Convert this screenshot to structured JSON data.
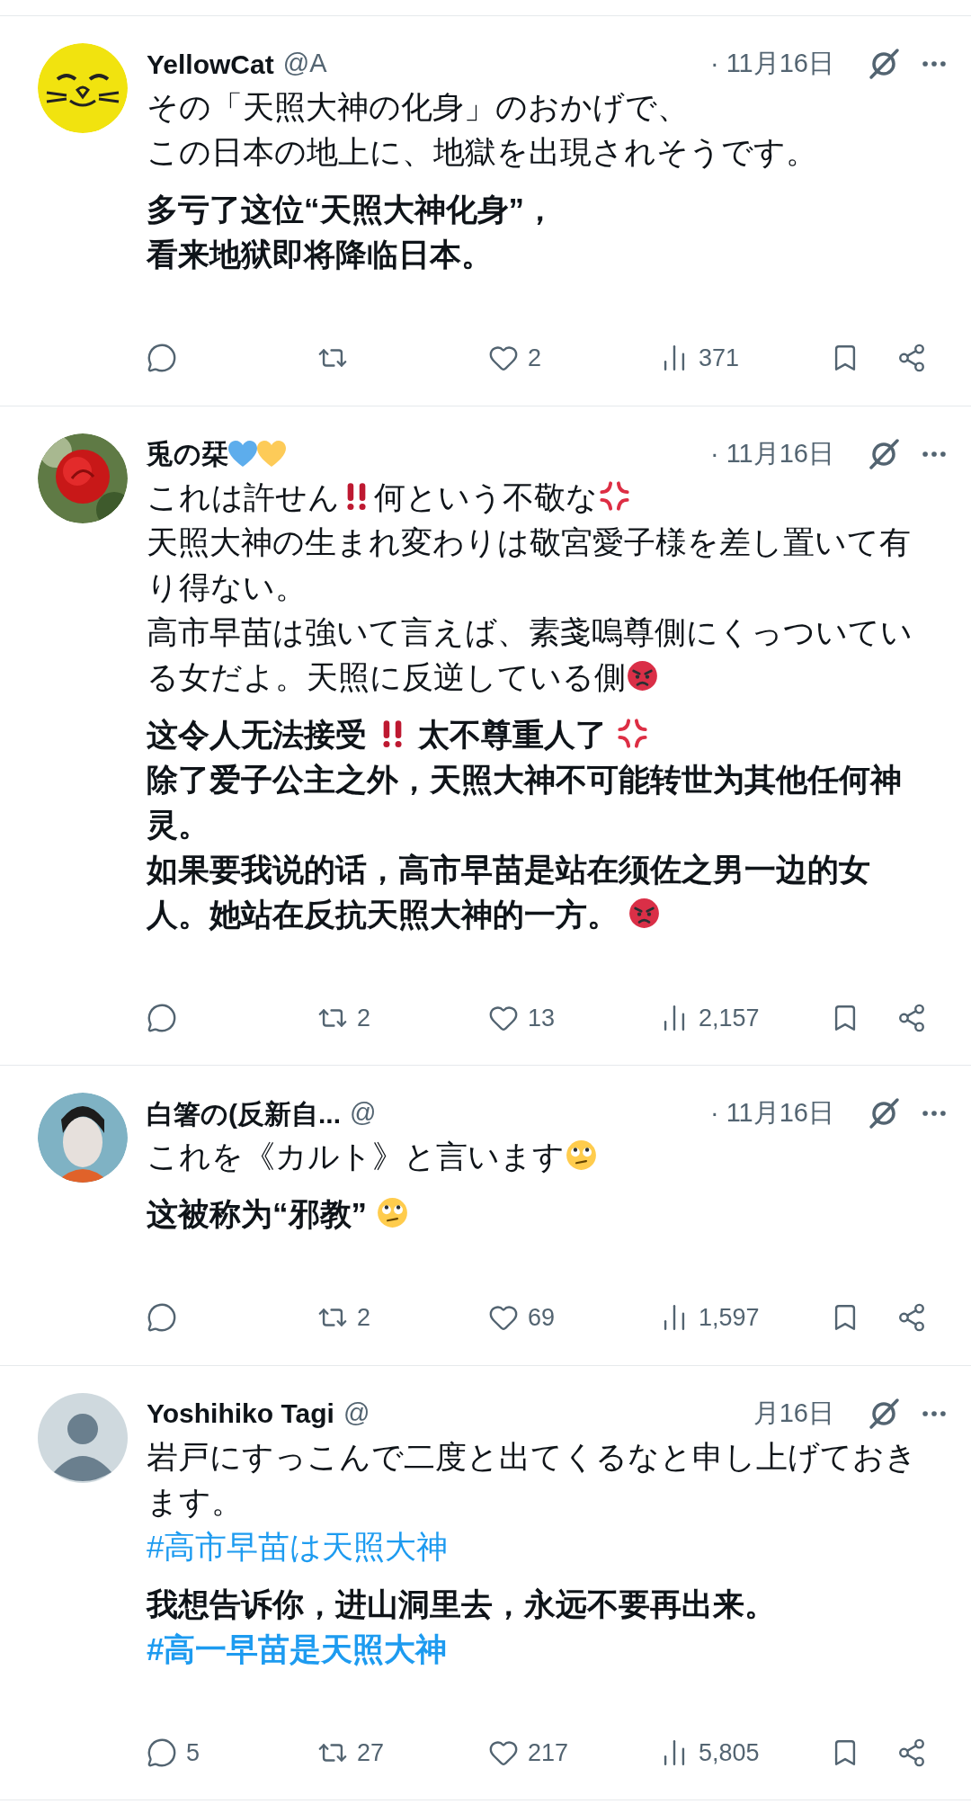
{
  "tweets": [
    {
      "avatar": {
        "kind": "cat"
      },
      "name": "YellowCat",
      "handle": "@A",
      "time": "· 11月16日",
      "blocks": [
        {
          "bold": false,
          "lines": [
            [
              {
                "kind": "text",
                "text": "その「天照大神の化身」のおかげで、"
              }
            ],
            [
              {
                "kind": "text",
                "text": "この日本の地上に、地獄を出現されそうです。"
              }
            ]
          ]
        },
        {
          "bold": true,
          "lines": [
            [
              {
                "kind": "text",
                "text": "多亏了这位“天照大神化身”，"
              }
            ],
            [
              {
                "kind": "text",
                "text": "看来地狱即将降临日本。"
              }
            ]
          ]
        }
      ],
      "actions": [
        {
          "kind": "reply"
        },
        {
          "kind": "repost"
        },
        {
          "kind": "like",
          "count": "2"
        },
        {
          "kind": "views",
          "count": "371"
        },
        {
          "kind": "bookmark"
        },
        {
          "kind": "share"
        }
      ]
    },
    {
      "avatar": {
        "kind": "rose"
      },
      "name": "兎の栞",
      "name_hearts": [
        {
          "color": "#5dadec"
        },
        {
          "color": "#fdcb58"
        }
      ],
      "time": "· 11月16日",
      "blocks": [
        {
          "bold": false,
          "lines": [
            [
              {
                "kind": "text",
                "text": "これは許せん"
              },
              {
                "kind": "double-exclamation"
              },
              {
                "kind": "text",
                "text": "何という不敬な"
              },
              {
                "kind": "anger-symbol"
              }
            ],
            [
              {
                "kind": "text",
                "text": "天照大神の生まれ変わりは敬宮愛子様を差し置いて有り得ない。"
              }
            ],
            [
              {
                "kind": "text",
                "text": "高市早苗は強いて言えば、素戔嗚尊側にくっついている女だよ。天照に反逆している側"
              },
              {
                "kind": "angry-face"
              }
            ]
          ]
        },
        {
          "bold": true,
          "lines": [
            [
              {
                "kind": "text",
                "text": "这令人无法接受 "
              },
              {
                "kind": "double-exclamation"
              },
              {
                "kind": "text",
                "text": " 太不尊重人了 "
              },
              {
                "kind": "anger-symbol"
              }
            ],
            [
              {
                "kind": "text",
                "text": "除了爱子公主之外，天照大神不可能转世为其他任何神灵。"
              }
            ],
            [
              {
                "kind": "text",
                "text": "如果要我说的话，高市早苗是站在须佐之男一边的女人。她站在反抗天照大神的一方。 "
              },
              {
                "kind": "angry-face"
              }
            ]
          ]
        }
      ],
      "actions": [
        {
          "kind": "reply"
        },
        {
          "kind": "repost",
          "count": "2"
        },
        {
          "kind": "like",
          "count": "13"
        },
        {
          "kind": "views",
          "count": "2,157"
        },
        {
          "kind": "bookmark"
        },
        {
          "kind": "share"
        }
      ]
    },
    {
      "avatar": {
        "kind": "person"
      },
      "name": "白箸の(反新自...",
      "handle": "@",
      "time": "· 11月16日",
      "blocks": [
        {
          "bold": false,
          "lines": [
            [
              {
                "kind": "text",
                "text": "これを《カルト》と言います"
              },
              {
                "kind": "eye-roll-face"
              }
            ]
          ]
        },
        {
          "bold": true,
          "lines": [
            [
              {
                "kind": "text",
                "text": "这被称为“邪教” "
              },
              {
                "kind": "eye-roll-face"
              }
            ]
          ]
        }
      ],
      "actions": [
        {
          "kind": "reply"
        },
        {
          "kind": "repost",
          "count": "2"
        },
        {
          "kind": "like",
          "count": "69"
        },
        {
          "kind": "views",
          "count": "1,597"
        },
        {
          "kind": "bookmark"
        },
        {
          "kind": "share"
        }
      ]
    },
    {
      "avatar": {
        "kind": "default"
      },
      "name": "Yoshihiko Tagi",
      "handle": "@",
      "time": "月16日",
      "blocks": [
        {
          "bold": false,
          "lines": [
            [
              {
                "kind": "text",
                "text": "岩戸にすっこんで二度と出てくるなと申し上げておきます。"
              }
            ],
            [
              {
                "kind": "hashtag",
                "text": "#高市早苗は天照大神"
              }
            ]
          ]
        },
        {
          "bold": true,
          "lines": [
            [
              {
                "kind": "text",
                "text": "我想告诉你，进山洞里去，永远不要再出来。"
              }
            ],
            [
              {
                "kind": "hashtag",
                "text": "#高一早苗是天照大神"
              }
            ]
          ]
        }
      ],
      "actions": [
        {
          "kind": "reply",
          "count": "5"
        },
        {
          "kind": "repost",
          "count": "27"
        },
        {
          "kind": "like",
          "count": "217"
        },
        {
          "kind": "views",
          "count": "5,805"
        },
        {
          "kind": "bookmark"
        },
        {
          "kind": "share"
        }
      ]
    }
  ]
}
